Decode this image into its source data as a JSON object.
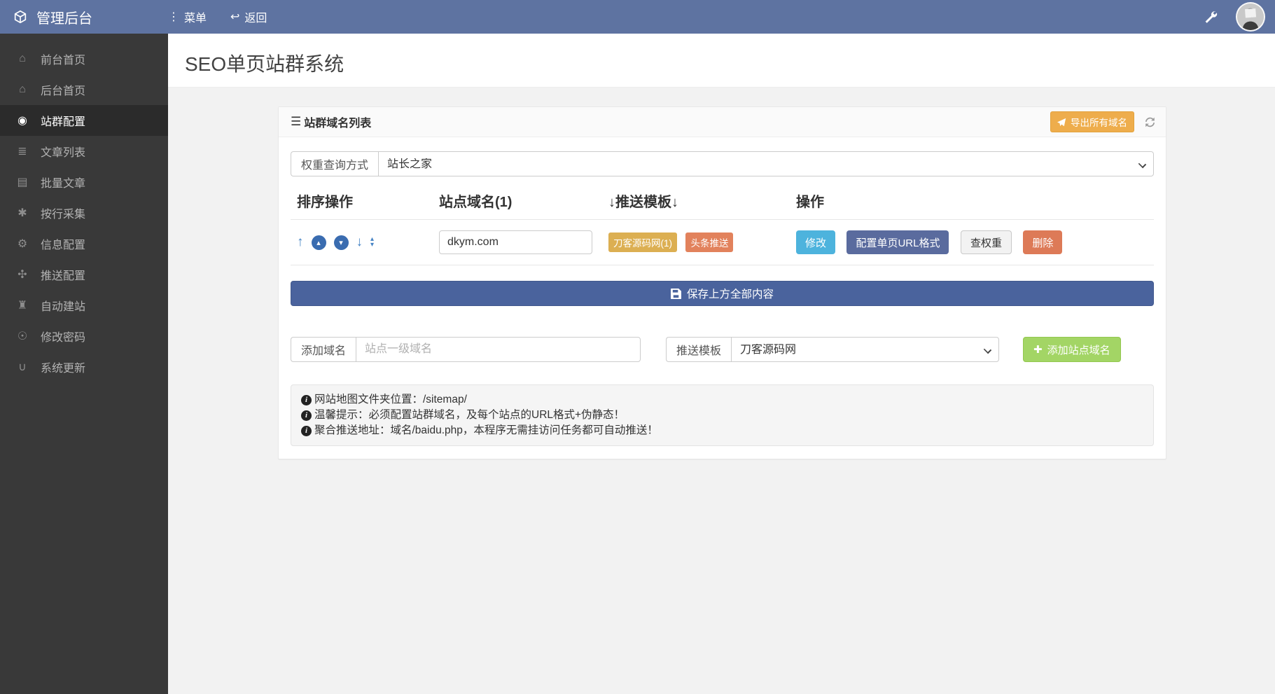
{
  "navbar": {
    "brand": "管理后台",
    "menu_label": "菜单",
    "menu_glyph": "⋮",
    "back_label": "返回",
    "back_glyph": "↩"
  },
  "sidebar": {
    "items": [
      {
        "label": "前台首页",
        "glyph": "⌂"
      },
      {
        "label": "后台首页",
        "glyph": "⌂"
      },
      {
        "label": "站群配置",
        "glyph": "◉"
      },
      {
        "label": "文章列表",
        "glyph": "≣"
      },
      {
        "label": "批量文章",
        "glyph": "▤"
      },
      {
        "label": "按行采集",
        "glyph": "✱"
      },
      {
        "label": "信息配置",
        "glyph": "⚙"
      },
      {
        "label": "推送配置",
        "glyph": "✣"
      },
      {
        "label": "自动建站",
        "glyph": "♜"
      },
      {
        "label": "修改密码",
        "glyph": "☉"
      },
      {
        "label": "系统更新",
        "glyph": "∪"
      }
    ]
  },
  "page": {
    "title": "SEO单页站群系统"
  },
  "panel": {
    "title": "站群域名列表",
    "title_glyph": "☰",
    "export_label": "导出所有域名",
    "weight_query": {
      "label": "权重查询方式",
      "value": "站长之家"
    },
    "table": {
      "headers": [
        "排序操作",
        "站点域名(1)",
        "↓推送模板↓",
        "操作"
      ],
      "sort_glyphs": {
        "up": "↑",
        "circle_up": "▴",
        "circle_down": "▾",
        "down": "↓",
        "tri_up": "▴",
        "tri_down": "▾"
      },
      "row": {
        "domain": "dkym.com",
        "badges": [
          "刀客源码网(1)",
          "头条推送"
        ],
        "actions": [
          "修改",
          "配置单页URL格式",
          "查权重",
          "删除"
        ]
      }
    },
    "save_label": "保存上方全部内容",
    "add_domain": {
      "label": "添加域名",
      "placeholder": "站点一级域名"
    },
    "push_template": {
      "label": "推送模板",
      "value": "刀客源码网"
    },
    "add_button_label": "添加站点域名",
    "add_button_glyph": "✚",
    "notes": [
      "网站地图文件夹位置：/sitemap/",
      "温馨提示：必须配置站群域名，及每个站点的URL格式+伪静态！",
      "聚合推送地址：域名/baidu.php，本程序无需挂访问任务都可自动推送！"
    ],
    "note_glyph": "i"
  },
  "colors": {
    "navbar": "#5e73a1",
    "sidebar": "#393939",
    "sidebar_active": "#2b2b2b",
    "export_button": "#eead4c",
    "badge_gold": "#dcaf52",
    "badge_orange": "#e2825c",
    "btn_edit": "#4db3dd",
    "btn_url": "#5a6b9e",
    "btn_delete": "#dd7a57",
    "btn_save": "#4a639d",
    "btn_add": "#a3d565"
  }
}
